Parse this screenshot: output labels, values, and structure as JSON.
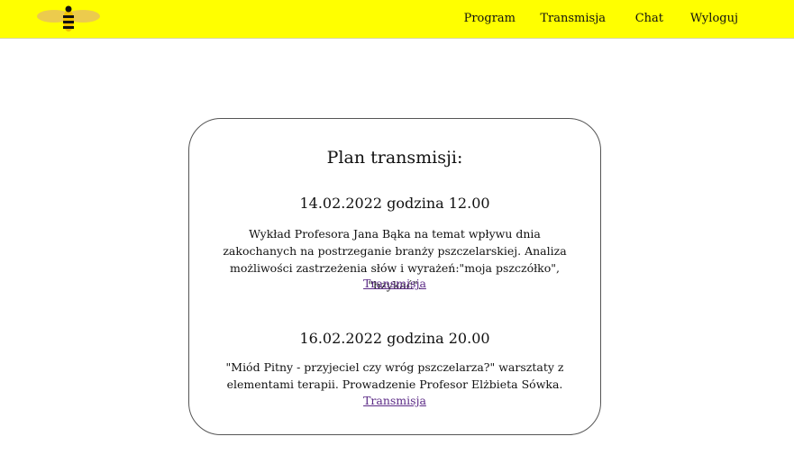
{
  "brand": {
    "logo_icon": "bee-icon",
    "colors": {
      "navbar_bg": "#ffff00",
      "link": "#5b2a86"
    }
  },
  "nav": {
    "items": [
      {
        "label": "Program"
      },
      {
        "label": "Transmisja"
      },
      {
        "label": "Chat"
      },
      {
        "label": "Wyloguj"
      }
    ]
  },
  "schedule": {
    "title": "Plan transmisji:",
    "events": [
      {
        "date": "14.02.2022 godzina 12.00",
        "description": "Wykład Profesora Jana Bąka na temat wpływu dnia zakochanych na postrzeganie branży pszczelarskiej. Analiza możliwości zastrzeżenia słów i wyrażeń:\"moja pszczółko\", \"bzykać\".",
        "link_label": "Transmisja"
      },
      {
        "date": "16.02.2022 godzina 20.00",
        "description": "\"Miód Pitny - przyjeciel czy wróg pszczelarza?\" warsztaty z elementami terapii. Prowadzenie Profesor Elżbieta Sówka.",
        "link_label": "Transmisja"
      }
    ]
  }
}
